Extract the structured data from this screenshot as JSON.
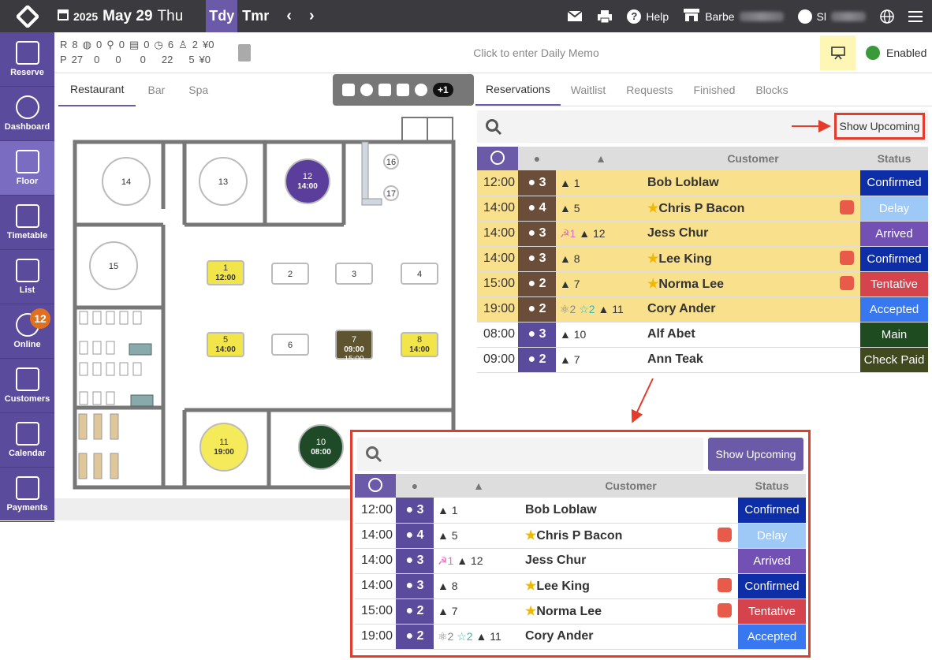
{
  "header": {
    "year": "2025",
    "month_day": "May 29",
    "weekday": "Thu",
    "today": "Tdy",
    "tomorrow": "Tmr",
    "help": "Help",
    "venue": "Barbe",
    "user": "Sl"
  },
  "sidebar": [
    {
      "label": "Reserve",
      "icon": "edit-icon"
    },
    {
      "label": "Dashboard",
      "icon": "gauge-icon"
    },
    {
      "label": "Floor",
      "icon": "floor-icon",
      "active": true
    },
    {
      "label": "Timetable",
      "icon": "timetable-icon"
    },
    {
      "label": "List",
      "icon": "list-icon"
    },
    {
      "label": "Online",
      "icon": "globe-icon",
      "badge": "12"
    },
    {
      "label": "Customers",
      "icon": "customers-icon"
    },
    {
      "label": "Calendar",
      "icon": "calendar-icon"
    },
    {
      "label": "Payments",
      "icon": "card-icon"
    }
  ],
  "stats": {
    "row1": [
      "R",
      "8",
      "0",
      "0",
      "0",
      "6",
      "2",
      "¥0"
    ],
    "row2": [
      "P",
      "27",
      "0",
      "0",
      "0",
      "22",
      "5",
      "¥0"
    ]
  },
  "memo": {
    "placeholder": "Click to enter Daily Memo",
    "status": "Enabled"
  },
  "left_tabs": [
    "Restaurant",
    "Bar",
    "Spa"
  ],
  "filter_badge": "+1",
  "right_tabs": [
    "Reservations",
    "Waitlist",
    "Requests",
    "Finished",
    "Blocks"
  ],
  "show_upcoming": "Show Upcoming",
  "columns": {
    "customer": "Customer",
    "status": "Status"
  },
  "tables": [
    {
      "n": "14"
    },
    {
      "n": "13"
    },
    {
      "n": "12",
      "time": "14:00"
    },
    {
      "n": "16"
    },
    {
      "n": "17"
    },
    {
      "n": "15"
    },
    {
      "n": "1",
      "time": "12:00"
    },
    {
      "n": "2"
    },
    {
      "n": "3"
    },
    {
      "n": "4"
    },
    {
      "n": "5",
      "time": "14:00"
    },
    {
      "n": "6"
    },
    {
      "n": "7",
      "time": "09:00",
      "time2": "15:00"
    },
    {
      "n": "8",
      "time": "14:00"
    },
    {
      "n": "11",
      "time": "19:00"
    },
    {
      "n": "10",
      "time": "08:00"
    }
  ],
  "reservations": [
    {
      "time": "12:00",
      "pax": "3",
      "table": "1",
      "customer": "Bob Loblaw",
      "status": "Confirmed",
      "cls": "c",
      "upcoming": true
    },
    {
      "time": "14:00",
      "pax": "4",
      "table": "5",
      "customer": "Chris P Bacon",
      "star": true,
      "smile": true,
      "status": "Delay",
      "cls": "d",
      "upcoming": true
    },
    {
      "time": "14:00",
      "pax": "3",
      "kids": "1",
      "table": "12",
      "customer": "Jess Chur",
      "status": "Arrived",
      "cls": "a",
      "upcoming": true
    },
    {
      "time": "14:00",
      "pax": "3",
      "table": "8",
      "customer": "Lee King",
      "star": true,
      "smile": true,
      "status": "Confirmed",
      "cls": "c",
      "upcoming": true
    },
    {
      "time": "15:00",
      "pax": "2",
      "table": "7",
      "customer": "Norma Lee",
      "star": true,
      "smile": true,
      "status": "Tentative",
      "cls": "t",
      "upcoming": true
    },
    {
      "time": "19:00",
      "pax": "2",
      "seniors": "2",
      "child": "2",
      "table": "11",
      "customer": "Cory Ander",
      "status": "Accepted",
      "cls": "ac",
      "upcoming": true
    },
    {
      "time": "08:00",
      "pax": "3",
      "table": "10",
      "customer": "Alf Abet",
      "status": "Main",
      "cls": "m"
    },
    {
      "time": "09:00",
      "pax": "2",
      "table": "7",
      "customer": "Ann Teak",
      "status": "Check Paid",
      "cls": "cp"
    }
  ]
}
